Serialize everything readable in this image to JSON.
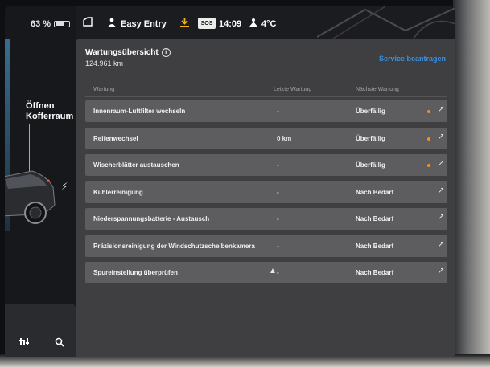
{
  "status_bar": {
    "battery_percent": "63 %",
    "battery_level": 0.63,
    "profile_name": "Easy Entry",
    "sos_label": "SOS",
    "time": "14:09",
    "temperature": "4°C"
  },
  "car_panel": {
    "trunk_label_line1": "Öffnen",
    "trunk_label_line2": "Kofferraum",
    "controls": [
      "sliders-icon",
      "search-icon"
    ]
  },
  "maintenance": {
    "title": "Wartungsübersicht",
    "odometer": "124.961 km",
    "service_link": "Service beantragen",
    "columns": {
      "task": "Wartung",
      "last": "Letzte Wartung",
      "next": "Nächste Wartung"
    },
    "rows": [
      {
        "task": "Innenraum-Luftfilter wechseln",
        "last": "-",
        "next": "Überfällig",
        "overdue": true
      },
      {
        "task": "Reifenwechsel",
        "last": "0 km",
        "next": "Überfällig",
        "overdue": true
      },
      {
        "task": "Wischerblätter austauschen",
        "last": "-",
        "next": "Überfällig",
        "overdue": true
      },
      {
        "task": "Kühlerreinigung",
        "last": "-",
        "next": "Nach Bedarf",
        "overdue": false
      },
      {
        "task": "Niederspannungsbatterie - Austausch",
        "last": "-",
        "next": "Nach Bedarf",
        "overdue": false
      },
      {
        "task": "Präzisionsreinigung der Windschutzscheibenkamera",
        "last": "-",
        "next": "Nach Bedarf",
        "overdue": false
      },
      {
        "task": "Spureinstellung überprüfen",
        "last": "-",
        "next": "Nach Bedarf",
        "overdue": false
      }
    ]
  },
  "colors": {
    "accent_blue": "#3c8fe0",
    "overdue_dot": "#ff8a1f",
    "row_bg": "#5d5d60",
    "card_bg": "#3f3f42"
  }
}
